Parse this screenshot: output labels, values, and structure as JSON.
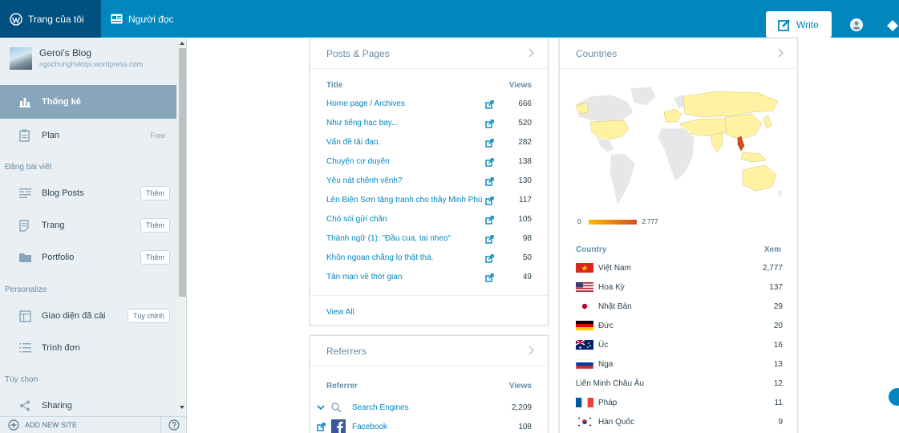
{
  "topbar": {
    "my_site": "Trang của tôi",
    "reader": "Người đọc",
    "write": "Write"
  },
  "sidebar": {
    "site_name": "Geroi's Blog",
    "site_url": "ngochunghvktqs.wordpress.com",
    "stats": "Thống kê",
    "plan": "Plan",
    "plan_badge": "Free",
    "publish_header": "Đăng bài viết",
    "blog_posts": "Blog Posts",
    "pages": "Trang",
    "portfolio": "Portfolio",
    "add_label": "Thêm",
    "personalize_header": "Personalize",
    "themes": "Giao diện đã cài",
    "customize": "Tùy chỉnh",
    "menus": "Trình đơn",
    "options_header": "Tùy chọn",
    "sharing": "Sharing",
    "add_new_site": "ADD NEW SITE"
  },
  "posts": {
    "title": "Posts & Pages",
    "col_title": "Title",
    "col_views": "Views",
    "rows": [
      {
        "title": "Home page / Archives",
        "views": "666"
      },
      {
        "title": "Như tiếng hạc bay...",
        "views": "520"
      },
      {
        "title": "Vấn đề tải đạo.",
        "views": "282"
      },
      {
        "title": "Chuyện cơ duyên",
        "views": "138"
      },
      {
        "title": "Yêu nát chênh vênh?",
        "views": "130"
      },
      {
        "title": "Lên Biện Sơn tặng tranh cho thầy Minh Phú",
        "views": "117"
      },
      {
        "title": "Chó sói gửi chắn",
        "views": "105"
      },
      {
        "title": "Thành ngữ (1): \"Đầu cua, tai nheo\"",
        "views": "98"
      },
      {
        "title": "Khôn ngoan chẳng lọ thật thà.",
        "views": "50"
      },
      {
        "title": "Tản mạn về thời gian",
        "views": "49"
      }
    ],
    "view_all": "View All"
  },
  "referrers": {
    "title": "Referrers",
    "col_referrer": "Referrer",
    "col_views": "Views",
    "rows": [
      {
        "name": "Search Engines",
        "views": "2,209"
      },
      {
        "name": "Facebook",
        "views": "108"
      }
    ]
  },
  "countries": {
    "title": "Countries",
    "legend_min": "0",
    "legend_max": "2.777",
    "col_country": "Country",
    "col_views": "Xem",
    "rows": [
      {
        "name": "Việt Nam",
        "views": "2,777"
      },
      {
        "name": "Hoa Kỳ",
        "views": "137"
      },
      {
        "name": "Nhật Bản",
        "views": "29"
      },
      {
        "name": "Đức",
        "views": "20"
      },
      {
        "name": "Úc",
        "views": "16"
      },
      {
        "name": "Nga",
        "views": "13"
      },
      {
        "name": "Liên Minh Châu Âu",
        "views": "12"
      },
      {
        "name": "Pháp",
        "views": "11"
      },
      {
        "name": "Hàn Quốc",
        "views": "9"
      }
    ]
  },
  "colors": {
    "topbar": "#0087be",
    "active": "#87a6bc",
    "link": "#0087be",
    "map_visited": "#fff3a3",
    "map_top": "#d54e21"
  }
}
